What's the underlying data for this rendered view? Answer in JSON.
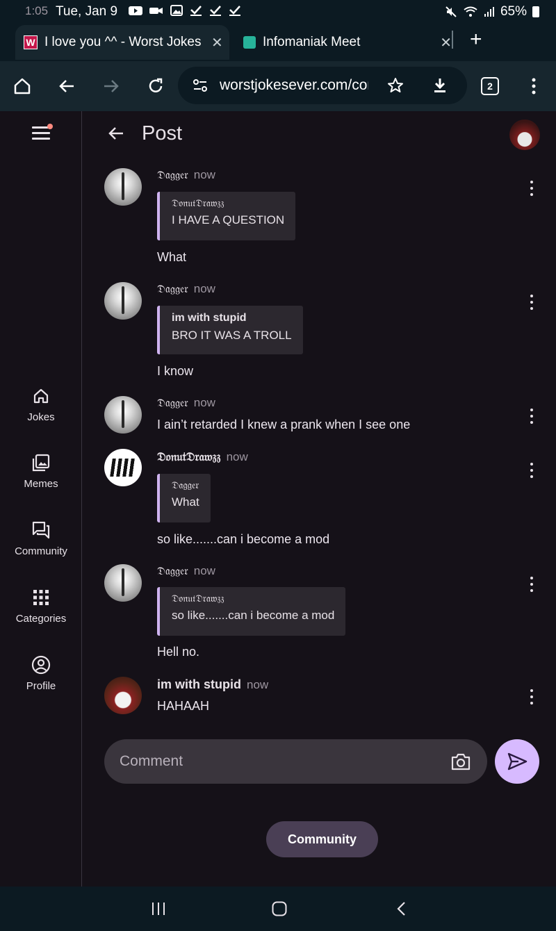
{
  "status_bar": {
    "time": "1:05",
    "date": "Tue, Jan 9",
    "battery": "65%"
  },
  "tabs": [
    {
      "title": "I love you ^^ - Worst Jokes Ever",
      "favicon": "W",
      "active": true
    },
    {
      "title": "Infomaniak Meet",
      "active": false
    }
  ],
  "toolbar": {
    "url": "worstjokesever.com/community",
    "tab_count": "2"
  },
  "sidebar": {
    "items": [
      {
        "label": "Jokes",
        "icon": "home-icon"
      },
      {
        "label": "Memes",
        "icon": "image-gallery-icon"
      },
      {
        "label": "Community",
        "icon": "chat-bubbles-icon"
      },
      {
        "label": "Categories",
        "icon": "grid-icon"
      },
      {
        "label": "Profile",
        "icon": "account-circle-icon"
      }
    ]
  },
  "post": {
    "title": "Post"
  },
  "comments": [
    {
      "author": "𝔇𝔞𝔤𝔤𝔢𝔯",
      "time": "now",
      "quote_author": "𝔇𝔬𝔫𝔲𝔱𝔇𝔯𝔞𝔴𝔷𝔷",
      "quote_text": "I HAVE A QUESTION",
      "text": "What"
    },
    {
      "author": "𝔇𝔞𝔤𝔤𝔢𝔯",
      "time": "now",
      "quote_author": "im with stupid",
      "quote_text": "BRO IT WAS A TROLL",
      "text": "I know"
    },
    {
      "author": "𝔇𝔞𝔤𝔤𝔢𝔯",
      "time": "now",
      "text": "I ain’t retarded I knew a prank when I see one"
    },
    {
      "author": "𝔇𝔬𝔫𝔲𝔱𝔇𝔯𝔞𝔴𝔷𝔷",
      "time": "now",
      "quote_author": "𝔇𝔞𝔤𝔤𝔢𝔯",
      "quote_text": "What",
      "text": "so like.......can i become a mod"
    },
    {
      "author": "𝔇𝔞𝔤𝔤𝔢𝔯",
      "time": "now",
      "quote_author": "𝔇𝔬𝔫𝔲𝔱𝔇𝔯𝔞𝔴𝔷𝔷",
      "quote_text": "so like.......can i become a mod",
      "text": "Hell no."
    },
    {
      "author": "im with stupid",
      "time": "now",
      "text": "HAHAAH"
    }
  ],
  "composer": {
    "placeholder": "Comment"
  },
  "community_button": "Community",
  "colors": {
    "accent": "#d7baff",
    "quote_bar": "#cfb3f0",
    "background": "#151118",
    "chrome": "#0c1a22"
  }
}
